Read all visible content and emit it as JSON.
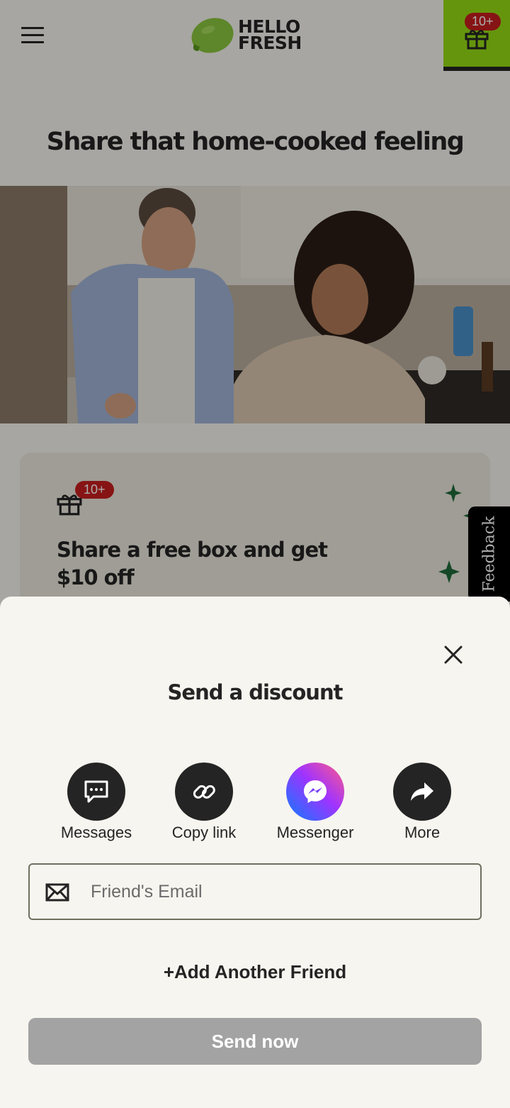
{
  "header": {
    "logo_line1": "HELLO",
    "logo_line2": "FRESH",
    "gift_badge": "10+"
  },
  "hero": {
    "title": "Share that home-cooked feeling"
  },
  "promo": {
    "badge": "10+",
    "title": "Share a free box and get $10 off"
  },
  "feedback": {
    "label": "Feedback"
  },
  "sheet": {
    "title": "Send a discount",
    "share_options": [
      {
        "label": "Messages",
        "icon": "message-icon"
      },
      {
        "label": "Copy link",
        "icon": "link-icon"
      },
      {
        "label": "Messenger",
        "icon": "messenger-icon"
      },
      {
        "label": "More",
        "icon": "share-arrow-icon"
      }
    ],
    "email_placeholder": "Friend's Email",
    "email_value": "",
    "add_friend": "+Add Another Friend",
    "send_button": "Send now"
  },
  "colors": {
    "brand_green": "#96dc14",
    "badge_red": "#c71e1e",
    "dark": "#242424",
    "disabled_button": "#a3a3a3"
  }
}
